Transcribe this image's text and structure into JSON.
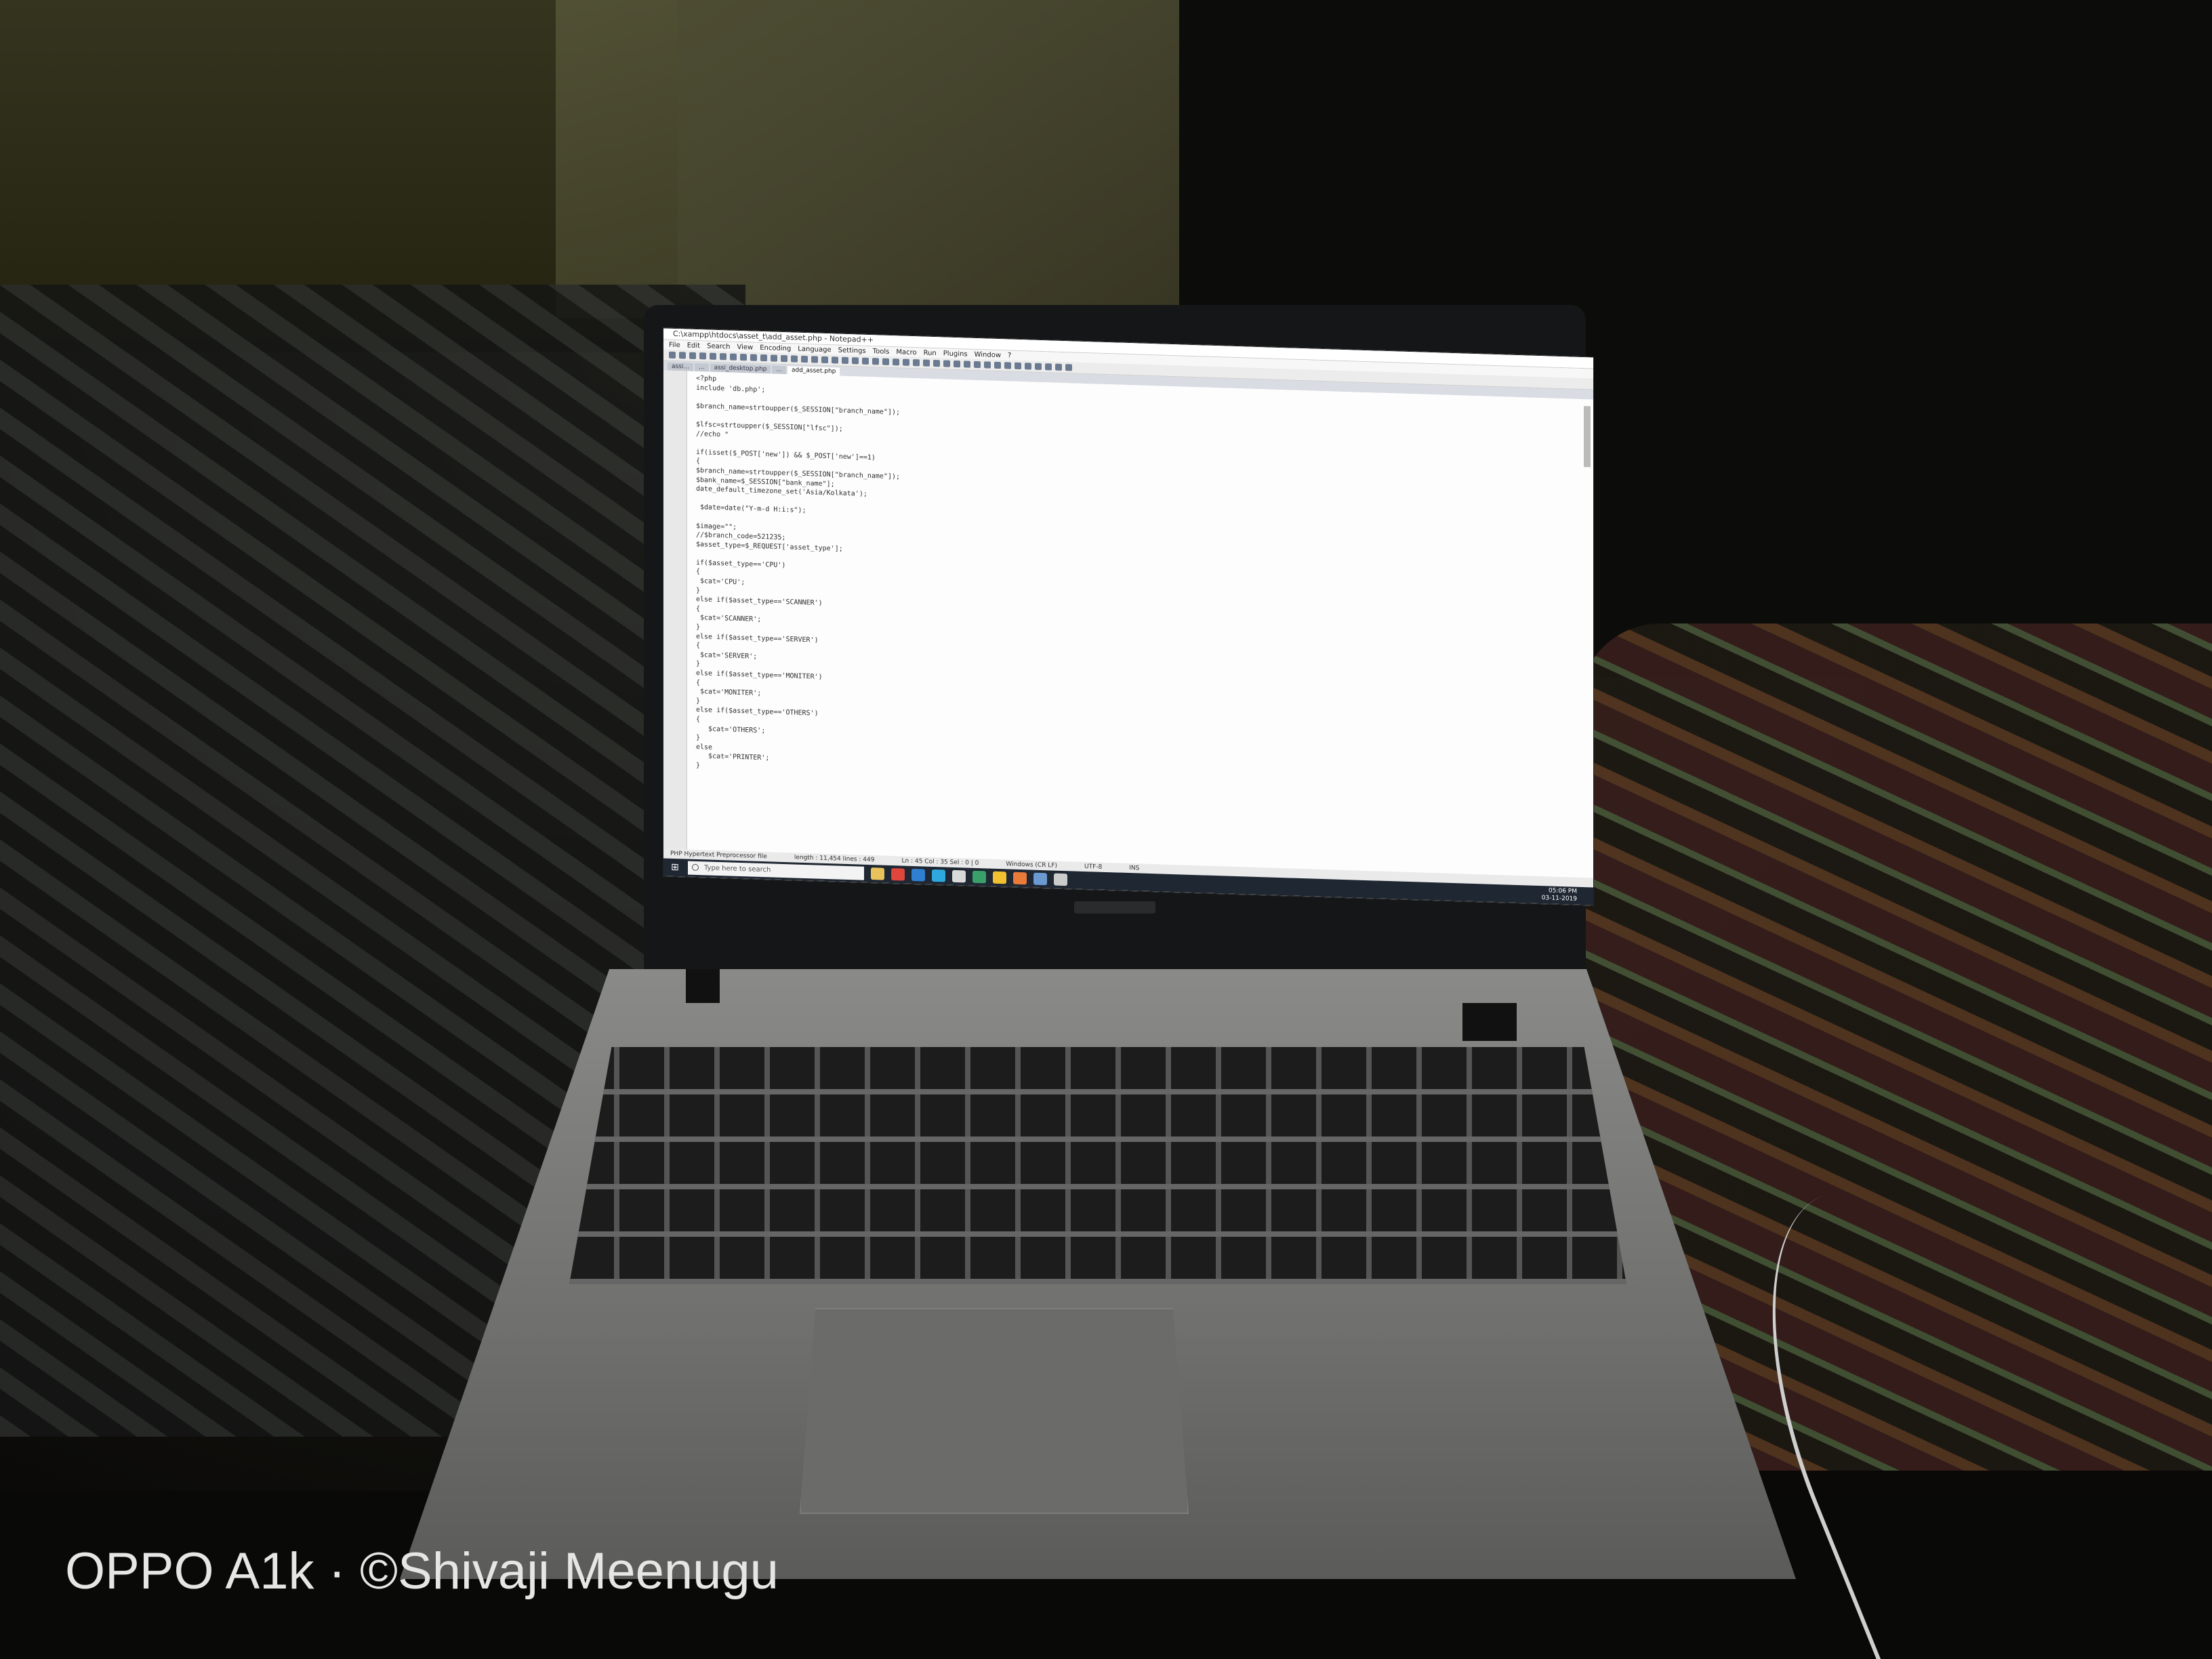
{
  "watermark": {
    "text": "OPPO A1k · ©Shivaji Meenugu"
  },
  "window": {
    "title": "C:\\xampp\\htdocs\\asset_t\\add_asset.php - Notepad++"
  },
  "menu": [
    "File",
    "Edit",
    "Search",
    "View",
    "Encoding",
    "Language",
    "Settings",
    "Tools",
    "Macro",
    "Run",
    "Plugins",
    "Window",
    "?"
  ],
  "tabs": [
    "assi...",
    "...",
    "assi_desktop.php",
    "...",
    "add_asset.php"
  ],
  "code_lines": [
    "<?php",
    "include 'db.php';",
    "",
    "$branch_name=strtoupper($_SESSION[\"branch_name\"]);",
    "",
    "$lfsc=strtoupper($_SESSION[\"lfsc\"]);",
    "//echo \"",
    "",
    "if(isset($_POST['new']) && $_POST['new']==1)",
    "{",
    "$branch_name=strtoupper($_SESSION[\"branch_name\"]);",
    "$bank_name=$_SESSION[\"bank_name\"];",
    "date_default_timezone_set('Asia/Kolkata');",
    "",
    " $date=date(\"Y-m-d H:i:s\");",
    "",
    "$image=\"\";",
    "//$branch_code=521235;",
    "$asset_type=$_REQUEST['asset_type'];",
    "",
    "if($asset_type=='CPU')",
    "{",
    " $cat='CPU';",
    "}",
    "else if($asset_type=='SCANNER')",
    "{",
    " $cat='SCANNER';",
    "}",
    "else if($asset_type=='SERVER')",
    "{",
    " $cat='SERVER';",
    "}",
    "else if($asset_type=='MONITER')",
    "{",
    " $cat='MONITER';",
    "}",
    "else if($asset_type=='OTHERS')",
    "{",
    "   $cat='OTHERS';",
    "}",
    "else",
    "   $cat='PRINTER';",
    "}"
  ],
  "statusbar": {
    "left": "PHP Hypertext Preprocessor file",
    "length": "length : 11,454    lines : 449",
    "pos": "Ln : 45    Col : 35    Sel : 0 | 0",
    "eol": "Windows (CR LF)",
    "enc": "UTF-8",
    "ins": "INS"
  },
  "taskbar": {
    "search_placeholder": "Type here to search",
    "time": "05:06 PM",
    "date": "03-11-2019",
    "icon_colors": [
      "#e8c25a",
      "#e0463c",
      "#2f80d1",
      "#2fa8e0",
      "#d9d9d9",
      "#3aa06a",
      "#f0c030",
      "#e87a3a",
      "#6a9ad0",
      "#cccccc"
    ]
  }
}
